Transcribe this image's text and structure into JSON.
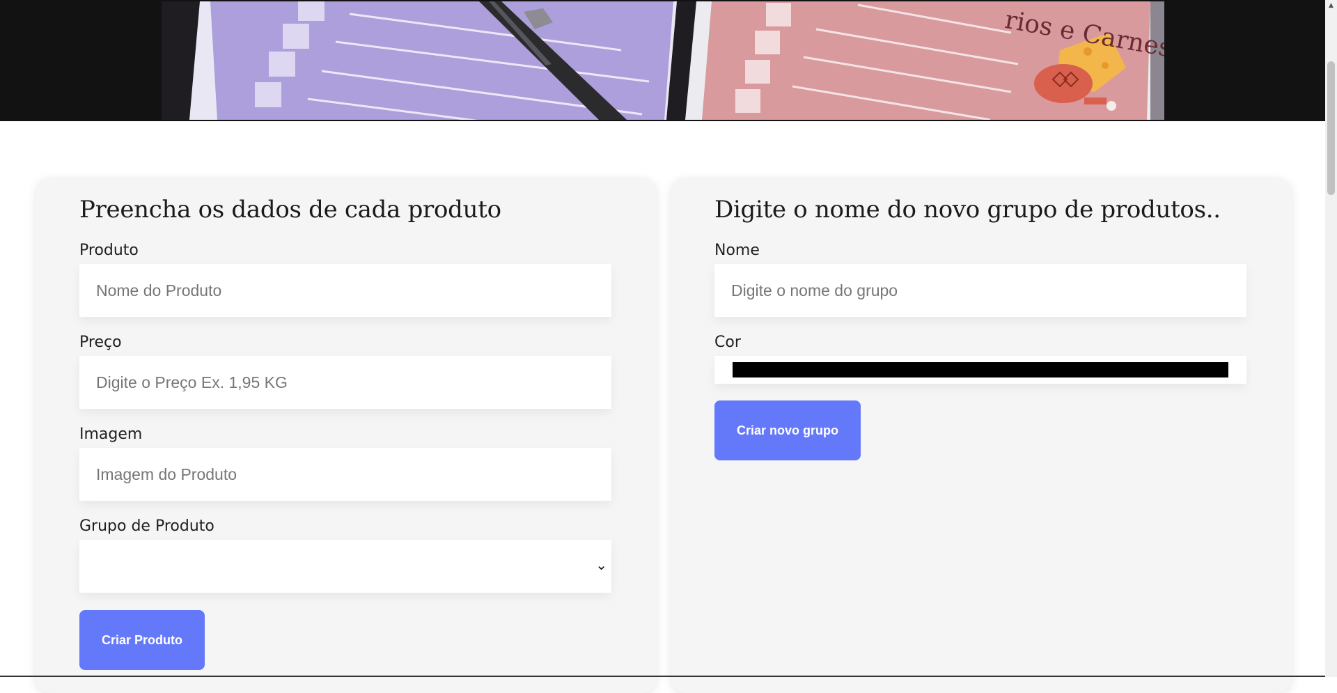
{
  "banner": {
    "caption": "rios e Carnes"
  },
  "product_form": {
    "title": "Preencha os dados de cada produto",
    "fields": {
      "product": {
        "label": "Produto",
        "placeholder": "Nome do Produto"
      },
      "price": {
        "label": "Preço",
        "placeholder": "Digite o Preço Ex. 1,95 KG"
      },
      "image": {
        "label": "Imagem",
        "placeholder": "Imagem do Produto"
      },
      "group": {
        "label": "Grupo de Produto",
        "selected": ""
      }
    },
    "submit_label": "Criar Produto"
  },
  "group_form": {
    "title": "Digite o nome do novo grupo de produtos..",
    "fields": {
      "name": {
        "label": "Nome",
        "placeholder": "Digite o nome do grupo"
      },
      "color": {
        "label": "Cor",
        "value": "#000000"
      }
    },
    "submit_label": "Criar novo grupo"
  },
  "theme": {
    "button_color": "#6478fa",
    "card_background": "#f5f5f5"
  },
  "icons": {
    "select_chevron": "chevron-down-icon",
    "scroll_up": "arrow-up-icon"
  }
}
